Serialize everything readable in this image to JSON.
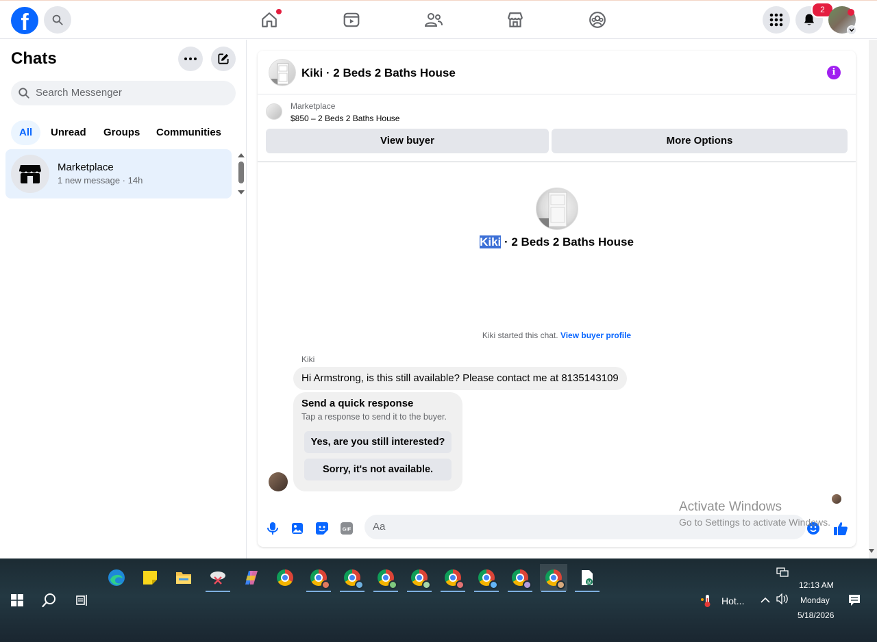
{
  "topbar": {
    "logo": "f",
    "notification_count": "2",
    "icons": [
      "search-icon",
      "home-icon",
      "video-icon",
      "friends-icon",
      "marketplace-icon",
      "groups-icon",
      "menu-grid-icon",
      "bell-icon",
      "profile-avatar"
    ]
  },
  "sidebar": {
    "title": "Chats",
    "search_placeholder": "Search Messenger",
    "filters": [
      "All",
      "Unread",
      "Groups",
      "Communities"
    ],
    "active_filter": "All",
    "chats": [
      {
        "name": "Marketplace",
        "preview": "1 new message · 14h"
      }
    ]
  },
  "conversation": {
    "header_title": "Kiki · 2 Beds 2 Baths House",
    "marketplace_label": "Marketplace",
    "listing": "$850 – 2 Beds 2 Baths House",
    "view_buyer": "View buyer",
    "more_options": "More Options",
    "center_name_highlight": "Kiki",
    "center_name_rest": " · 2 Beds 2 Baths House",
    "started_text": "Kiki started this chat. ",
    "view_buyer_profile": "View buyer profile",
    "sender": "Kiki",
    "message": "Hi Armstrong, is this still available? Please contact me at 8135143109",
    "quick_title": "Send a quick response",
    "quick_sub": "Tap a response to send it to the buyer.",
    "quick_replies": [
      "Yes, are you still interested?",
      "Sorry, it's not available."
    ],
    "input_placeholder": "Aa"
  },
  "watermark": {
    "line1": "Activate Windows",
    "line2": "Go to Settings to activate Windows."
  },
  "taskbar": {
    "weather": "Hot...",
    "time": "12:13 AM",
    "day": "Monday",
    "date": "5/18/2026"
  },
  "colors": {
    "brand": "#0866ff",
    "notification": "#e41e3f",
    "info": "#a020f0",
    "selected_chat": "#e7f1fd"
  }
}
